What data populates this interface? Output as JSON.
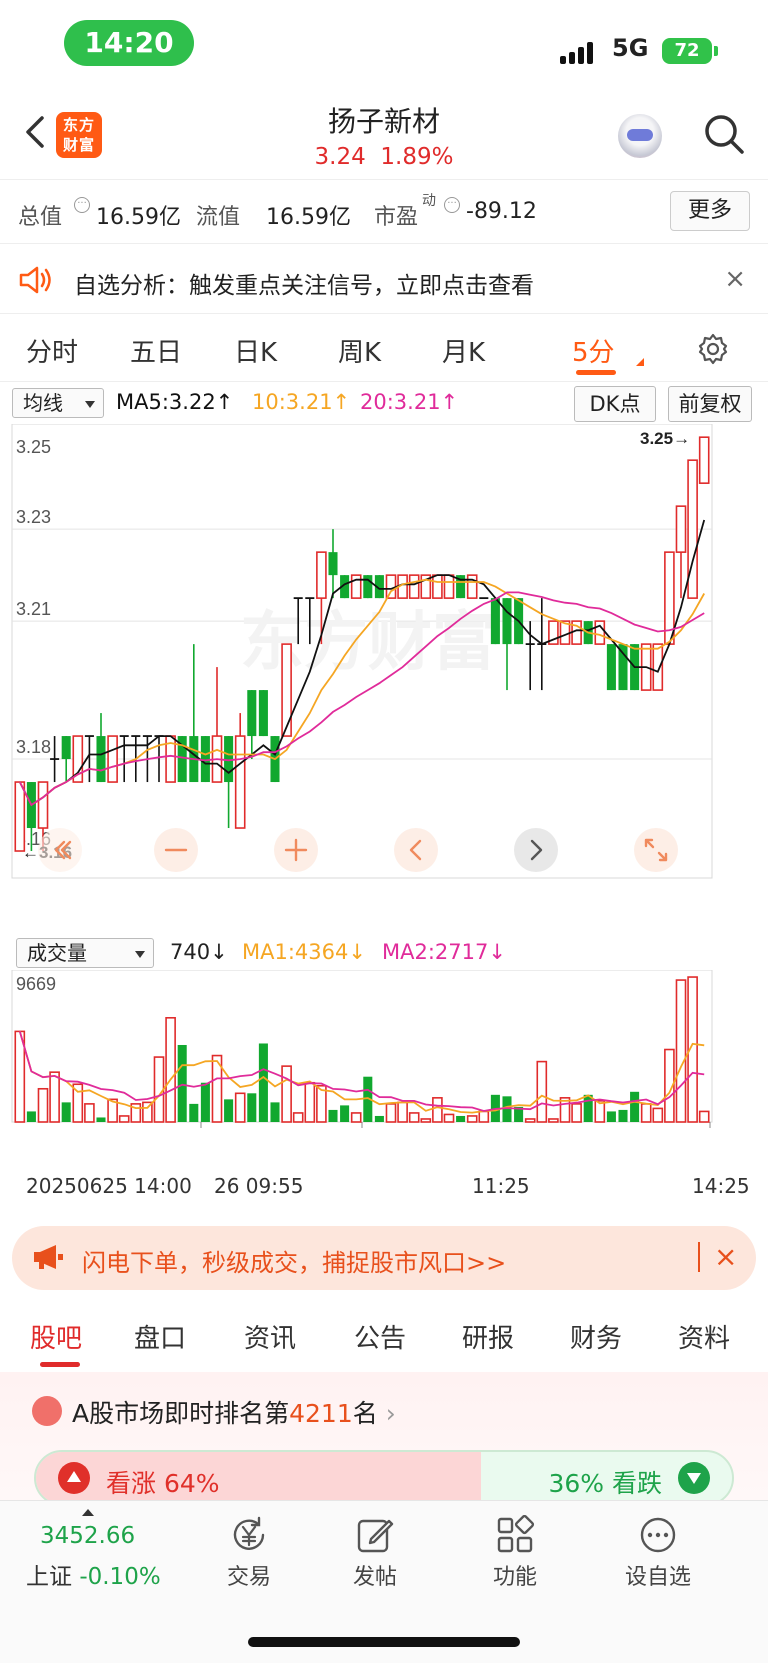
{
  "status": {
    "time": "14:20",
    "network": "5G",
    "battery": "72"
  },
  "header": {
    "logo": "东方\n财富",
    "logo_line1": "东方",
    "logo_line2": "财富",
    "name": "扬子新材",
    "price": "3.24",
    "change": "1.89%"
  },
  "info": {
    "total_label": "总值",
    "total_value": "16.59亿",
    "float_label": "流值",
    "float_value": "16.59亿",
    "pe_label": "市盈",
    "pe_sup": "动",
    "pe_value": "-89.12",
    "more": "更多"
  },
  "notice": {
    "text": "自选分析：触发重点关注信号，立即点击查看",
    "close": "×"
  },
  "period_tabs": [
    "分时",
    "五日",
    "日K",
    "周K",
    "月K",
    "5分"
  ],
  "active_period": "5分",
  "ma_row": {
    "selector": "均线",
    "ma5": "MA5:3.22↑",
    "ma10": "10:3.21↑",
    "ma20": "20:3.21↑",
    "dk": "DK点",
    "adjust": "前复权"
  },
  "colors": {
    "up": "#e02b2b",
    "down": "#11a82f",
    "ma5": "#111111",
    "ma10": "#f5a623",
    "ma20": "#e02b9a",
    "accent": "#ff5a14"
  },
  "chart_data": [
    {
      "type": "candlestick",
      "title": "",
      "y_ticks": [
        "3.25",
        "3.23",
        "3.21",
        "3.18",
        "3.16"
      ],
      "high_label": "3.25",
      "low_label": "3.16",
      "ylim": [
        3.155,
        3.252
      ],
      "candles": [
        {
          "o": 3.16,
          "c": 3.175,
          "h": 3.175,
          "l": 3.16
        },
        {
          "o": 3.175,
          "c": 3.165,
          "h": 3.175,
          "l": 3.16
        },
        {
          "o": 3.165,
          "c": 3.175,
          "h": 3.175,
          "l": 3.16
        },
        {
          "o": 3.18,
          "c": 3.18,
          "h": 3.185,
          "l": 3.175
        },
        {
          "o": 3.185,
          "c": 3.18,
          "h": 3.185,
          "l": 3.175
        },
        {
          "o": 3.175,
          "c": 3.185,
          "h": 3.185,
          "l": 3.175
        },
        {
          "o": 3.185,
          "c": 3.185,
          "h": 3.185,
          "l": 3.175
        },
        {
          "o": 3.185,
          "c": 3.175,
          "h": 3.19,
          "l": 3.175
        },
        {
          "o": 3.175,
          "c": 3.185,
          "h": 3.185,
          "l": 3.175
        },
        {
          "o": 3.185,
          "c": 3.185,
          "h": 3.185,
          "l": 3.175
        },
        {
          "o": 3.185,
          "c": 3.185,
          "h": 3.185,
          "l": 3.175
        },
        {
          "o": 3.185,
          "c": 3.185,
          "h": 3.185,
          "l": 3.175
        },
        {
          "o": 3.185,
          "c": 3.185,
          "h": 3.185,
          "l": 3.175
        },
        {
          "o": 3.175,
          "c": 3.185,
          "h": 3.185,
          "l": 3.175
        },
        {
          "o": 3.185,
          "c": 3.175,
          "h": 3.185,
          "l": 3.175
        },
        {
          "o": 3.185,
          "c": 3.175,
          "h": 3.205,
          "l": 3.175
        },
        {
          "o": 3.185,
          "c": 3.175,
          "h": 3.185,
          "l": 3.175
        },
        {
          "o": 3.175,
          "c": 3.185,
          "h": 3.2,
          "l": 3.175
        },
        {
          "o": 3.185,
          "c": 3.175,
          "h": 3.185,
          "l": 3.165
        },
        {
          "o": 3.165,
          "c": 3.185,
          "h": 3.19,
          "l": 3.165
        },
        {
          "o": 3.195,
          "c": 3.185,
          "h": 3.195,
          "l": 3.18
        },
        {
          "o": 3.195,
          "c": 3.185,
          "h": 3.195,
          "l": 3.185
        },
        {
          "o": 3.185,
          "c": 3.175,
          "h": 3.185,
          "l": 3.175
        },
        {
          "o": 3.185,
          "c": 3.205,
          "h": 3.205,
          "l": 3.185
        },
        {
          "o": 3.215,
          "c": 3.215,
          "h": 3.215,
          "l": 3.205
        },
        {
          "o": 3.215,
          "c": 3.215,
          "h": 3.215,
          "l": 3.205
        },
        {
          "o": 3.215,
          "c": 3.225,
          "h": 3.225,
          "l": 3.205
        },
        {
          "o": 3.225,
          "c": 3.22,
          "h": 3.23,
          "l": 3.215
        },
        {
          "o": 3.22,
          "c": 3.215,
          "h": 3.22,
          "l": 3.215
        },
        {
          "o": 3.215,
          "c": 3.22,
          "h": 3.22,
          "l": 3.215
        },
        {
          "o": 3.22,
          "c": 3.215,
          "h": 3.22,
          "l": 3.215
        },
        {
          "o": 3.22,
          "c": 3.215,
          "h": 3.22,
          "l": 3.215
        },
        {
          "o": 3.215,
          "c": 3.22,
          "h": 3.22,
          "l": 3.215
        },
        {
          "o": 3.215,
          "c": 3.22,
          "h": 3.22,
          "l": 3.215
        },
        {
          "o": 3.215,
          "c": 3.22,
          "h": 3.22,
          "l": 3.215
        },
        {
          "o": 3.215,
          "c": 3.22,
          "h": 3.22,
          "l": 3.215
        },
        {
          "o": 3.215,
          "c": 3.22,
          "h": 3.22,
          "l": 3.215
        },
        {
          "o": 3.215,
          "c": 3.22,
          "h": 3.22,
          "l": 3.215
        },
        {
          "o": 3.22,
          "c": 3.215,
          "h": 3.22,
          "l": 3.215
        },
        {
          "o": 3.215,
          "c": 3.22,
          "h": 3.22,
          "l": 3.215
        },
        {
          "o": 3.215,
          "c": 3.215,
          "h": 3.215,
          "l": 3.215
        },
        {
          "o": 3.215,
          "c": 3.205,
          "h": 3.215,
          "l": 3.205
        },
        {
          "o": 3.215,
          "c": 3.205,
          "h": 3.215,
          "l": 3.195
        },
        {
          "o": 3.215,
          "c": 3.205,
          "h": 3.215,
          "l": 3.205
        },
        {
          "o": 3.205,
          "c": 3.205,
          "h": 3.21,
          "l": 3.195
        },
        {
          "o": 3.205,
          "c": 3.205,
          "h": 3.215,
          "l": 3.195
        },
        {
          "o": 3.205,
          "c": 3.21,
          "h": 3.21,
          "l": 3.205
        },
        {
          "o": 3.205,
          "c": 3.21,
          "h": 3.21,
          "l": 3.205
        },
        {
          "o": 3.205,
          "c": 3.21,
          "h": 3.21,
          "l": 3.205
        },
        {
          "o": 3.21,
          "c": 3.205,
          "h": 3.21,
          "l": 3.205
        },
        {
          "o": 3.205,
          "c": 3.21,
          "h": 3.21,
          "l": 3.205
        },
        {
          "o": 3.205,
          "c": 3.195,
          "h": 3.205,
          "l": 3.195
        },
        {
          "o": 3.205,
          "c": 3.195,
          "h": 3.205,
          "l": 3.195
        },
        {
          "o": 3.205,
          "c": 3.195,
          "h": 3.205,
          "l": 3.195
        },
        {
          "o": 3.195,
          "c": 3.205,
          "h": 3.205,
          "l": 3.195
        },
        {
          "o": 3.195,
          "c": 3.205,
          "h": 3.205,
          "l": 3.195
        },
        {
          "o": 3.205,
          "c": 3.225,
          "h": 3.225,
          "l": 3.205
        },
        {
          "o": 3.225,
          "c": 3.235,
          "h": 3.235,
          "l": 3.215
        },
        {
          "o": 3.215,
          "c": 3.245,
          "h": 3.245,
          "l": 3.215
        },
        {
          "o": 3.24,
          "c": 3.25,
          "h": 3.25,
          "l": 3.24
        }
      ],
      "legend": [
        "MA5",
        "MA10",
        "MA20"
      ]
    },
    {
      "type": "bar",
      "title": "",
      "y_ticks": [
        "9669"
      ],
      "ylim": [
        0,
        9669
      ],
      "x_ticks": [
        "20250625 14:00",
        "26 09:55",
        "11:25",
        "14:25"
      ],
      "values": [
        6000,
        700,
        2200,
        3300,
        1300,
        2500,
        1200,
        300,
        1500,
        400,
        1200,
        1300,
        4300,
        6900,
        5100,
        1200,
        2600,
        4400,
        1500,
        1900,
        1900,
        5200,
        1300,
        3700,
        600,
        2600,
        2400,
        800,
        1100,
        600,
        3000,
        400,
        1200,
        1300,
        600,
        200,
        1600,
        500,
        400,
        400,
        700,
        1800,
        1700,
        1000,
        200,
        4000,
        200,
        1600,
        1200,
        1800,
        1400,
        700,
        800,
        2000,
        1200,
        900,
        4800,
        9400,
        9600,
        700
      ],
      "volume": "740↓",
      "ma1": "MA1:4364↓",
      "ma2": "MA2:2717↓",
      "selector": "成交量"
    }
  ],
  "chart_controls": [
    "zoom-out",
    "zoom-in",
    "prev",
    "next",
    "fullscreen"
  ],
  "banner": {
    "text": "闪电下单，秒级成交，捕捉股市风口>>",
    "close": "×"
  },
  "bottom_tabs": [
    "股吧",
    "盘口",
    "资讯",
    "公告",
    "研报",
    "财务",
    "资料"
  ],
  "ranking": {
    "prefix": "A股市场即时排名第",
    "rank": "4211",
    "suffix": "名",
    "arrow": "›"
  },
  "vote": {
    "up_label": "看涨 64%",
    "down_label": "36% 看跌",
    "up_pct": 64
  },
  "bottom_nav": {
    "index_value": "3452.66",
    "index_name": "上证",
    "index_change": "-0.10%",
    "items": [
      "交易",
      "发帖",
      "功能",
      "设自选"
    ]
  }
}
